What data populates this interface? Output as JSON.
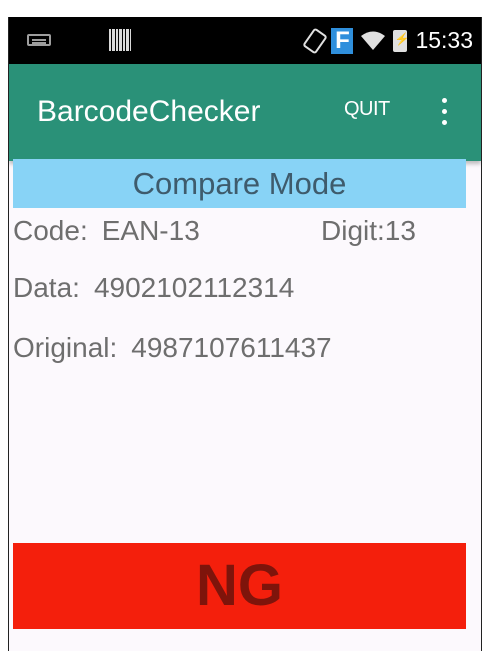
{
  "status_bar": {
    "time": "15:33",
    "icons": [
      "keyboard-icon",
      "barcode-icon",
      "screen-rotation-icon",
      "f-app-icon",
      "wifi-icon",
      "battery-charging-icon"
    ],
    "f_label": "F"
  },
  "toolbar": {
    "title": "BarcodeChecker",
    "quit_label": "QUIT",
    "accent_color": "#2a9178"
  },
  "main": {
    "mode_label": "Compare Mode",
    "code_label": "Code:",
    "code_value": "EAN-13",
    "digit_label": "Digit:",
    "digit_value": "13",
    "data_label": "Data:",
    "data_value": "4902102112314",
    "original_label": "Original:",
    "original_value": "4987107611437",
    "result_label": "NG",
    "result_color": "#f41f0c"
  }
}
